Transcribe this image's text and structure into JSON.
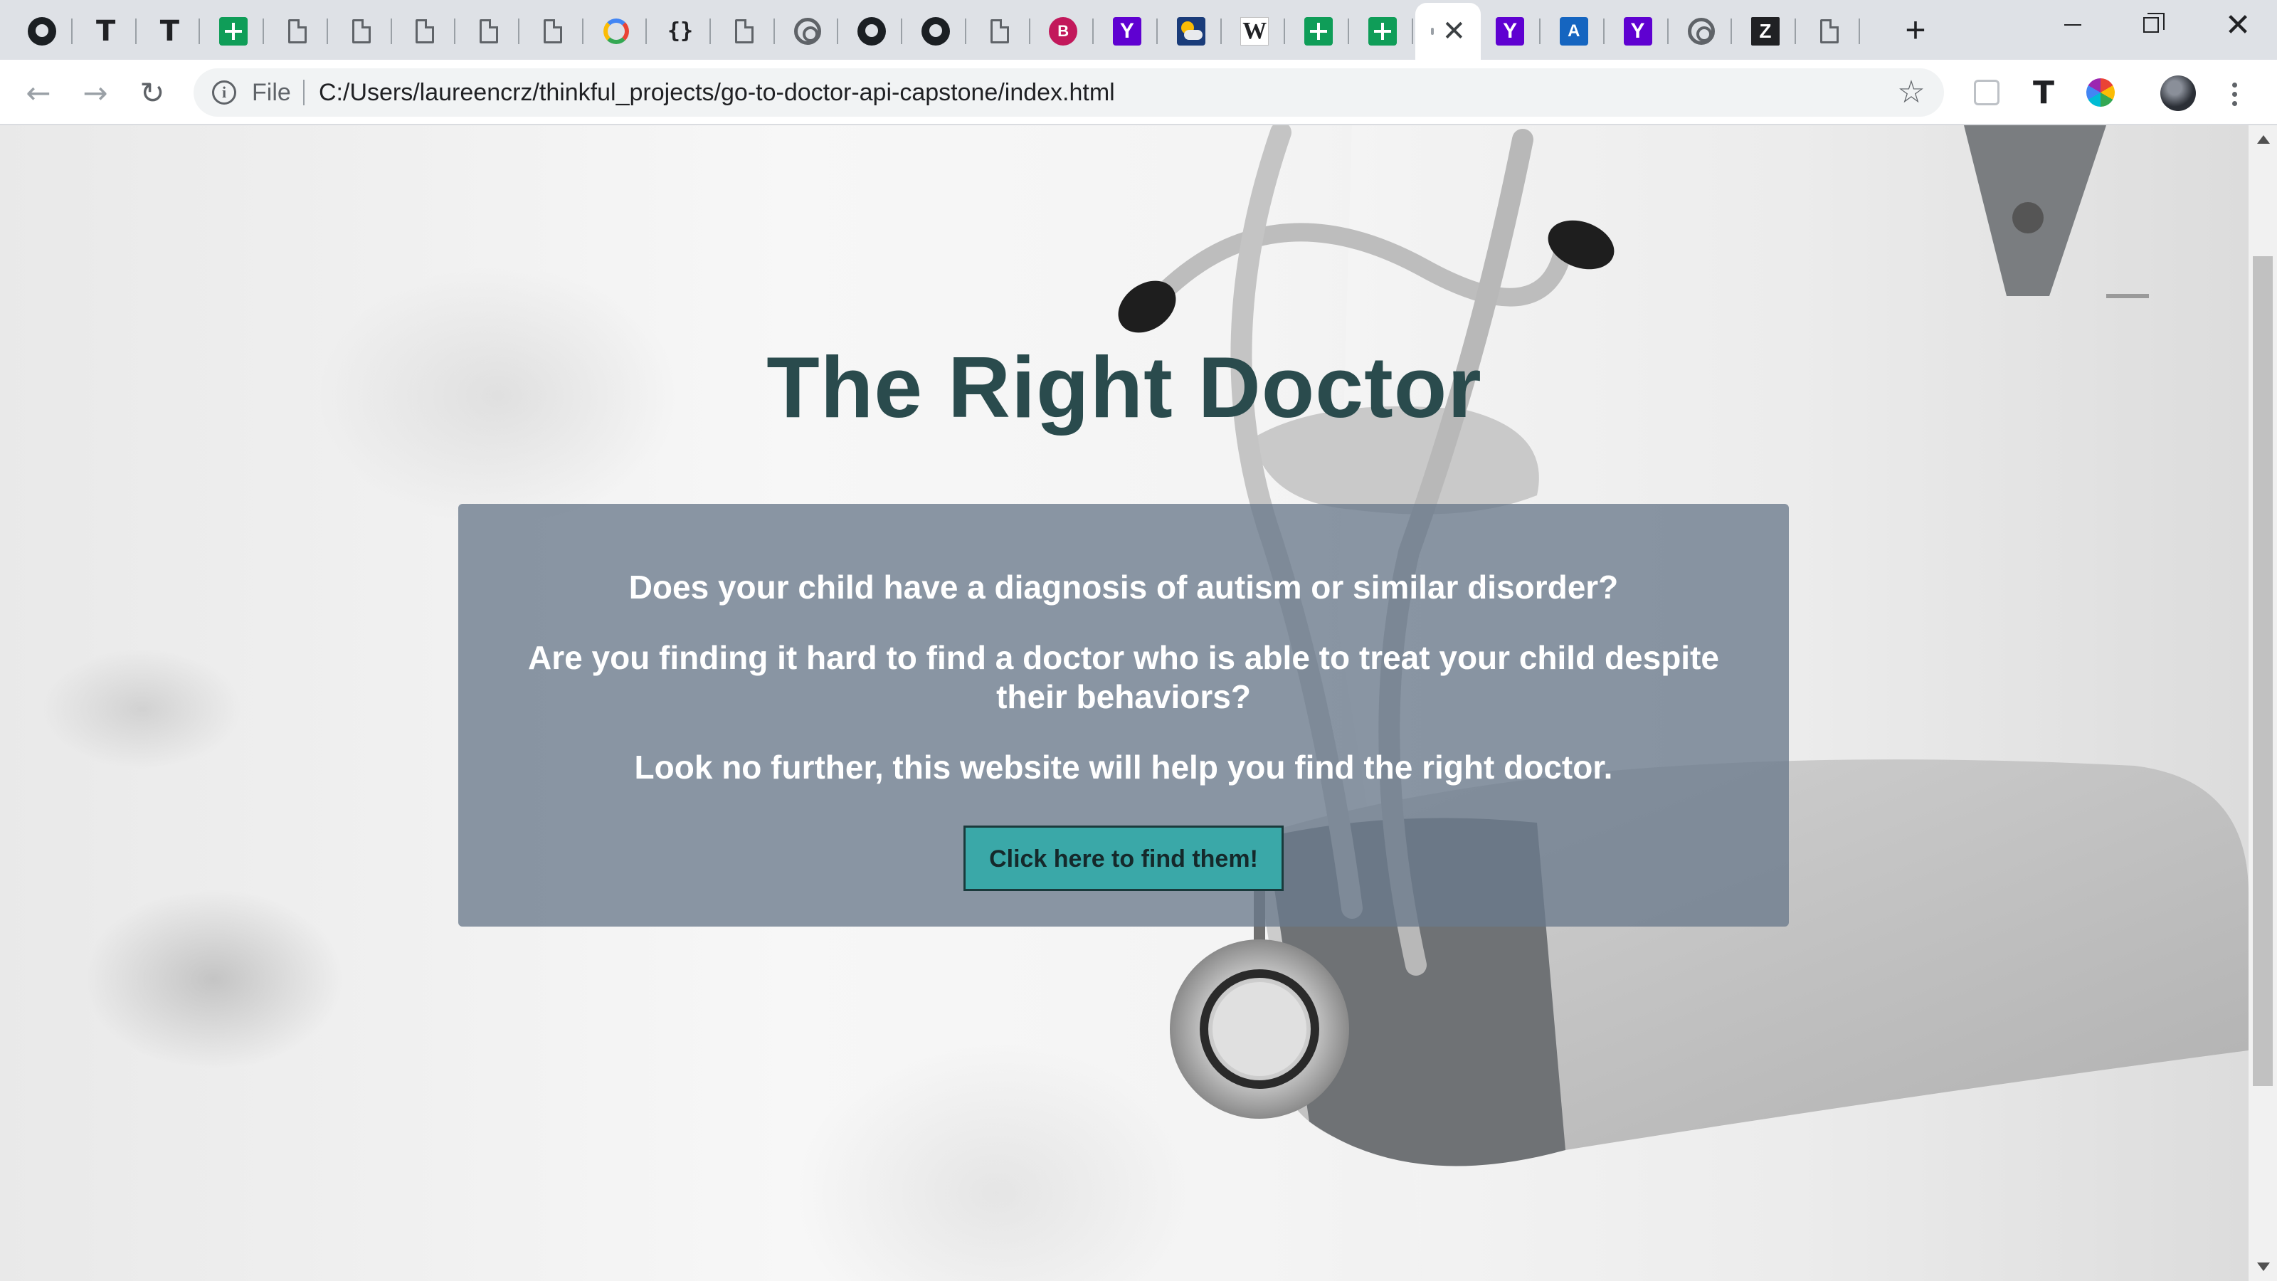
{
  "browser": {
    "tabs": [
      {
        "icon": "github-icon",
        "glyph": ""
      },
      {
        "icon": "typora-t-icon",
        "glyph": "T"
      },
      {
        "icon": "typora-t-icon",
        "glyph": "T"
      },
      {
        "icon": "google-sheets-icon",
        "glyph": ""
      },
      {
        "icon": "document-icon",
        "glyph": ""
      },
      {
        "icon": "document-icon",
        "glyph": ""
      },
      {
        "icon": "document-icon",
        "glyph": ""
      },
      {
        "icon": "document-icon",
        "glyph": ""
      },
      {
        "icon": "document-icon",
        "glyph": ""
      },
      {
        "icon": "google-icon",
        "glyph": ""
      },
      {
        "icon": "json-braces-icon",
        "glyph": "{}"
      },
      {
        "icon": "document-icon",
        "glyph": ""
      },
      {
        "icon": "swirl-icon",
        "glyph": ""
      },
      {
        "icon": "github-icon",
        "glyph": ""
      },
      {
        "icon": "github-icon",
        "glyph": ""
      },
      {
        "icon": "document-icon",
        "glyph": ""
      },
      {
        "icon": "pink-circle-icon",
        "glyph": "B"
      },
      {
        "icon": "yahoo-icon",
        "glyph": "Y"
      },
      {
        "icon": "weather-icon",
        "glyph": ""
      },
      {
        "icon": "wikipedia-icon",
        "glyph": "W"
      },
      {
        "icon": "google-sheets-icon",
        "glyph": ""
      },
      {
        "icon": "google-sheets-icon",
        "glyph": ""
      },
      {
        "icon": "active-tab",
        "glyph": ""
      },
      {
        "icon": "yahoo-icon",
        "glyph": "Y"
      },
      {
        "icon": "translate-icon",
        "glyph": "A"
      },
      {
        "icon": "yahoo-icon",
        "glyph": "Y"
      },
      {
        "icon": "swirl-icon",
        "glyph": ""
      },
      {
        "icon": "zillow-icon",
        "glyph": "Z"
      },
      {
        "icon": "document-icon",
        "glyph": ""
      }
    ],
    "active_tab_index": 22,
    "new_tab_glyph": "+",
    "window_close_glyph": "✕",
    "nav": {
      "back_glyph": "←",
      "forward_glyph": "→",
      "reload_glyph": "↻"
    },
    "omnibox": {
      "info_glyph": "i",
      "scheme_label": "File",
      "url": "C:/Users/laureencrz/thinkful_projects/go-to-doctor-api-capstone/index.html",
      "star_glyph": "☆"
    },
    "extensions": [
      "pocket-icon",
      "typora-t-icon",
      "color-picker-icon"
    ],
    "ext_t_glyph": "T"
  },
  "page": {
    "title": "The Right Doctor",
    "hero": {
      "question1": "Does your child have a diagnosis of autism or similar disorder?",
      "question2": "Are you finding it hard to find a doctor who is able to treat your child despite their behaviors?",
      "statement": "Look no further, this website will help you find the right doctor.",
      "cta_label": "Click here to find them!"
    }
  },
  "colors": {
    "title": "#2a4b4d",
    "hero_box": "#6a7a8c",
    "cta_background": "#3aa8a8",
    "cta_border": "#1a3a3c"
  }
}
